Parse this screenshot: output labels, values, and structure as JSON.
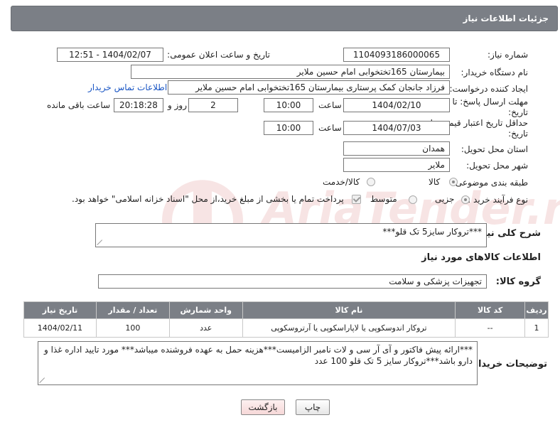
{
  "header": {
    "title": "جزئیات اطلاعات نیاز"
  },
  "fields": {
    "need_number_label": "شماره نیاز:",
    "need_number": "1104093186000065",
    "announce_label": "تاریخ و ساعت اعلان عمومی:",
    "announce_value": "1404/02/07 - 12:51",
    "buyer_org_label": "نام دستگاه خریدار:",
    "buyer_org": "بیمارستان 165تختخوابی امام حسین ملایر",
    "creator_label": "ایجاد کننده درخواست:",
    "creator": "فرزاد جانجان کمک پرستاری بیمارستان 165تختخوابی امام حسین ملایر",
    "buyer_contact_link": "اطلاعات تماس خریدار",
    "deadline_label": "مهلت ارسال پاسخ: تا تاریخ:",
    "deadline_date": "1404/02/10",
    "time_label": "ساعت",
    "deadline_time": "10:00",
    "days_value": "2",
    "days_label": "روز و",
    "remaining_time": "20:18:28",
    "remaining_label": "ساعت باقی مانده",
    "min_price_label": "حداقل تاریخ اعتبار قیمت: تا تاریخ:",
    "min_price_date": "1404/07/03",
    "min_price_time": "10:00",
    "province_label": "استان محل تحویل:",
    "province": "همدان",
    "city_label": "شهر محل تحویل:",
    "city": "ملایر",
    "category_label": "طبقه بندی موضوعی:",
    "category_options": [
      "کالا",
      "کالا/خدمت"
    ],
    "purchase_type_label": "نوع فرآیند خرید :",
    "purchase_options": [
      "جزیی",
      "متوسط"
    ],
    "payment_note": "پرداخت تمام یا بخشی از مبلغ خرید،از محل \"اسناد خزانه اسلامی\" خواهد بود."
  },
  "description": {
    "label": "شرح کلی نیاز:",
    "value": "***تروکار سایز5 تک قلو***"
  },
  "goods": {
    "section_title": "اطلاعات کالاهای مورد نیاز",
    "group_label": "گروه کالا:",
    "group_value": "تجهیزات پزشکی و سلامت",
    "columns": [
      "ردیف",
      "کد کالا",
      "نام کالا",
      "واحد شمارش",
      "تعداد / مقدار",
      "تاریخ نیاز"
    ],
    "rows": [
      [
        "1",
        "--",
        "تروکار اندوسکوپی یا لاپاراسکوپی یا آرتروسکوپی",
        "عدد",
        "100",
        "1404/02/11"
      ]
    ]
  },
  "buyer_notes": {
    "label": "توضیحات خریدار:",
    "value": "***ارائه پیش فاکتور و آی آر سی و لات نامبر الزامیست***هزینه حمل به عهده فروشنده میباشد*** مورد تایید اداره غذا و دارو باشد***تروکار سایز 5 تک قلو  100 عدد"
  },
  "buttons": {
    "print": "چاپ",
    "back": "بازگشت"
  },
  "watermark": {
    "text": "AriaTender.neT"
  }
}
